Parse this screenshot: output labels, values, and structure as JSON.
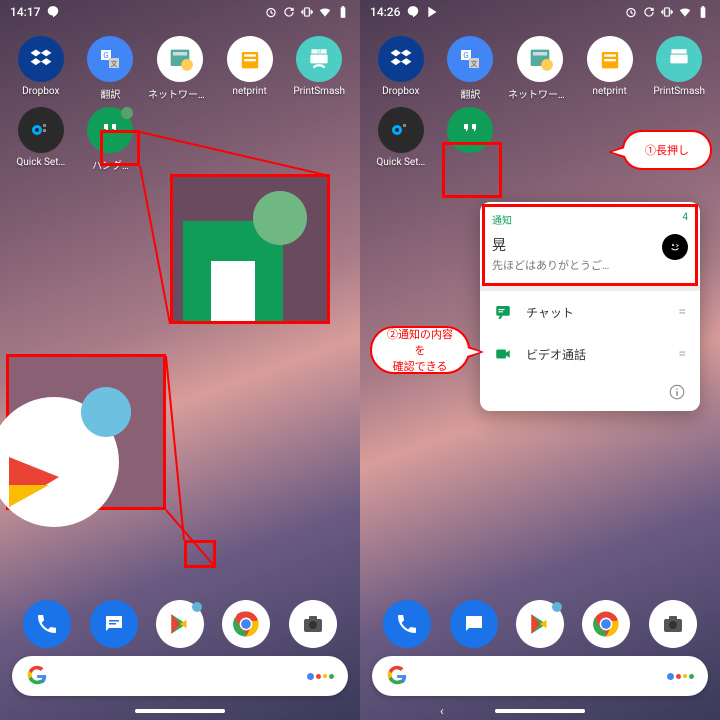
{
  "left": {
    "time": "14:17",
    "apps_row1": [
      {
        "label": "Dropbox"
      },
      {
        "label": "翻訳"
      },
      {
        "label": "ネットワークフ…"
      },
      {
        "label": "netprint"
      },
      {
        "label": "PrintSmash"
      }
    ],
    "apps_row2": [
      {
        "label": "Quick Set…"
      },
      {
        "label": "ハング…"
      }
    ],
    "dot_color_hangouts": "#5aa06a",
    "dot_color_play": "#5eb3d6"
  },
  "right": {
    "time": "14:26",
    "apps_row1": [
      {
        "label": "Dropbox"
      },
      {
        "label": "翻訳"
      },
      {
        "label": "ネットワークフ…"
      },
      {
        "label": "netprint"
      },
      {
        "label": "PrintSmash"
      }
    ],
    "apps_row2": [
      {
        "label": "Quick Set…"
      },
      {
        "label": ""
      }
    ],
    "callout1": "①長押し",
    "callout2": "②通知の内容を\n確認できる",
    "popup": {
      "header": "通知",
      "count": "4",
      "title": "晃",
      "body": "先ほどはありがとうご…",
      "item1": "チャット",
      "item2": "ビデオ通話"
    }
  },
  "colors": {
    "dropbox": "#0a3d91",
    "translate": "#4285f4",
    "network": "#ffffff",
    "netprint": "#ffffff",
    "printsmash": "#4ecdc4",
    "quickset": "#2a2a2a",
    "hangouts": "#0f9d58",
    "phone": "#1a73e8",
    "messages": "#1a73e8",
    "play": "#ffffff",
    "chrome": "#ffffff",
    "camera": "#ffffff"
  }
}
